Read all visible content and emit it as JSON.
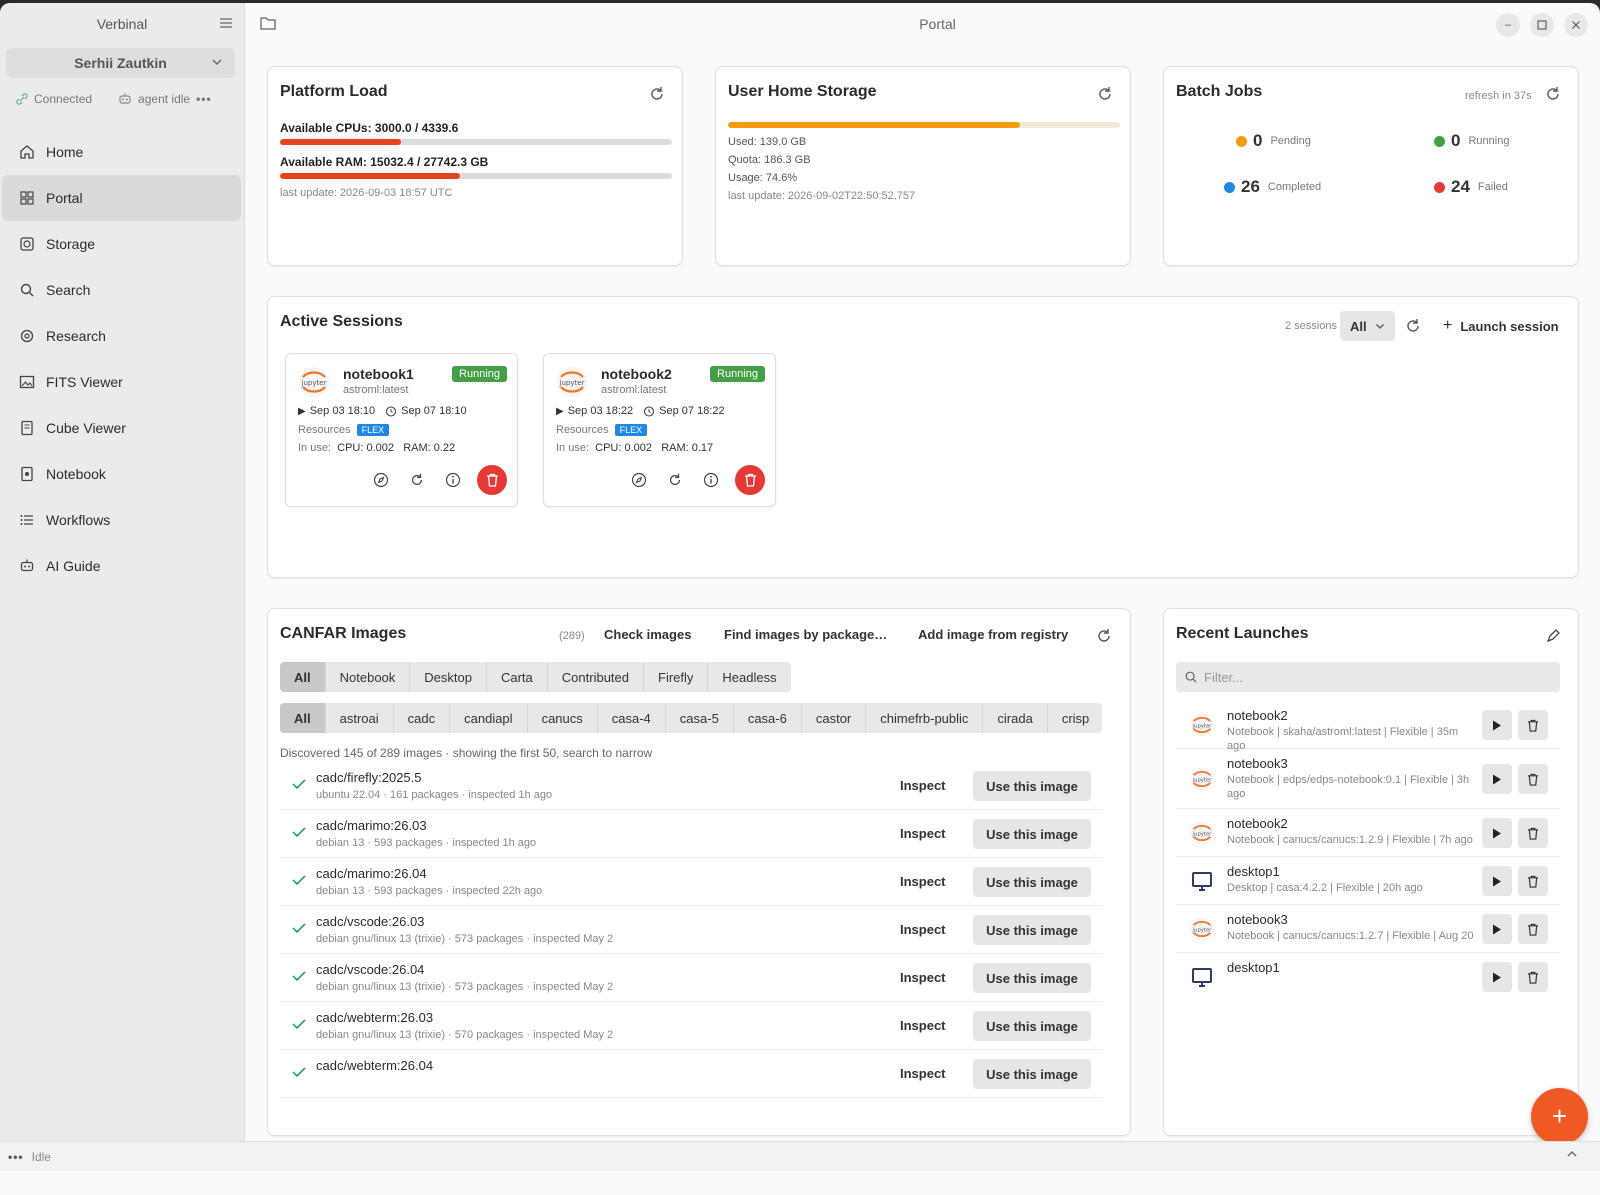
{
  "window": {
    "title": "Portal"
  },
  "sidebar": {
    "title": "Verbinal",
    "user": "Serhii Zautkin",
    "connection": "Connected",
    "agent": "agent idle",
    "items": [
      {
        "label": "Home",
        "icon": "home-icon"
      },
      {
        "label": "Portal",
        "icon": "grid-icon",
        "active": true
      },
      {
        "label": "Storage",
        "icon": "storage-icon"
      },
      {
        "label": "Search",
        "icon": "search-icon"
      },
      {
        "label": "Research",
        "icon": "research-icon"
      },
      {
        "label": "FITS Viewer",
        "icon": "image-icon"
      },
      {
        "label": "Cube Viewer",
        "icon": "cube-icon"
      },
      {
        "label": "Notebook",
        "icon": "notebook-icon"
      },
      {
        "label": "Workflows",
        "icon": "list-icon"
      },
      {
        "label": "AI Guide",
        "icon": "robot-icon"
      }
    ]
  },
  "platform_load": {
    "title": "Platform Load",
    "cpu_label": "Available CPUs: 3000.0 / 4339.6",
    "cpu_fraction": 0.309,
    "ram_label": "Available RAM: 15032.4 / 27742.3 GB",
    "ram_fraction": 0.458,
    "updated": "last update: 2026-09-03 18:57 UTC"
  },
  "storage": {
    "title": "User Home Storage",
    "usage_fraction": 0.746,
    "used": "Used: 139.0 GB",
    "quota": "Quota: 186.3 GB",
    "usage": "Usage: 74.6%",
    "updated": "last update: 2026-09-02T22:50:52.757"
  },
  "batch": {
    "title": "Batch Jobs",
    "refresh": "refresh in 37s",
    "pending": {
      "count": "0",
      "label": "Pending"
    },
    "running": {
      "count": "0",
      "label": "Running"
    },
    "completed": {
      "count": "26",
      "label": "Completed"
    },
    "failed": {
      "count": "24",
      "label": "Failed"
    }
  },
  "sessions": {
    "title": "Active Sessions",
    "count": "2 sessions",
    "filter": "All",
    "launch": "Launch session",
    "items": [
      {
        "name": "notebook1",
        "image": "astroml:latest",
        "status": "Running",
        "start": "Sep 03 18:10",
        "end": "Sep 07 18:10",
        "resources": "Resources",
        "flex": "FLEX",
        "in_use": "In use:",
        "cpu": "CPU: 0.002",
        "ram": "RAM: 0.22"
      },
      {
        "name": "notebook2",
        "image": "astroml:latest",
        "status": "Running",
        "start": "Sep 03 18:22",
        "end": "Sep 07 18:22",
        "resources": "Resources",
        "flex": "FLEX",
        "in_use": "In use:",
        "cpu": "CPU: 0.002",
        "ram": "RAM: 0.17"
      }
    ]
  },
  "images": {
    "title": "CANFAR Images",
    "count": "(289)",
    "check": "Check images",
    "find": "Find images by package…",
    "add": "Add image from registry",
    "types": [
      "All",
      "Notebook",
      "Desktop",
      "Carta",
      "Contributed",
      "Firefly",
      "Headless"
    ],
    "projects": [
      "All",
      "astroai",
      "cadc",
      "candiapl",
      "canucs",
      "casa-4",
      "casa-5",
      "casa-6",
      "castor",
      "chimefrb-public",
      "cirada",
      "crisp"
    ],
    "summary": "Discovered 145 of 289 images · showing the first 50, search to narrow",
    "inspect": "Inspect",
    "use": "Use this image",
    "rows": [
      {
        "name": "cadc/firefly:2025.5",
        "meta": "ubuntu 22.04 · 161 packages · inspected 1h ago"
      },
      {
        "name": "cadc/marimo:26.03",
        "meta": "debian 13 · 593 packages · inspected 1h ago"
      },
      {
        "name": "cadc/marimo:26.04",
        "meta": "debian 13 · 593 packages · inspected 22h ago"
      },
      {
        "name": "cadc/vscode:26.03",
        "meta": "debian gnu/linux 13 (trixie) · 573 packages · inspected May 2"
      },
      {
        "name": "cadc/vscode:26.04",
        "meta": "debian gnu/linux 13 (trixie) · 573 packages · inspected May 2"
      },
      {
        "name": "cadc/webterm:26.03",
        "meta": "debian gnu/linux 13 (trixie) · 570 packages · inspected May 2"
      },
      {
        "name": "cadc/webterm:26.04",
        "meta": ""
      }
    ]
  },
  "recent": {
    "title": "Recent Launches",
    "filter_placeholder": "Filter...",
    "rows": [
      {
        "name": "notebook2",
        "meta": "Notebook | skaha/astroml:latest | Flexible | 35m ago",
        "kind": "jupyter"
      },
      {
        "name": "notebook3",
        "meta": "Notebook | edps/edps-notebook:0.1 | Flexible | 3h ago",
        "kind": "jupyter"
      },
      {
        "name": "notebook2",
        "meta": "Notebook | canucs/canucs:1.2.9 | Flexible | 7h ago",
        "kind": "jupyter"
      },
      {
        "name": "desktop1",
        "meta": "Desktop | casa:4.2.2 | Flexible | 20h ago",
        "kind": "desktop"
      },
      {
        "name": "notebook3",
        "meta": "Notebook | canucs/canucs:1.2.7 | Flexible | Aug 20",
        "kind": "jupyter"
      },
      {
        "name": "desktop1",
        "meta": "",
        "kind": "desktop"
      }
    ]
  },
  "statusbar": {
    "text": "Idle"
  },
  "colors": {
    "accent": "#ef5a24",
    "running": "#43a047",
    "danger": "#e53935",
    "flex": "#1e88e5",
    "storage": "#f39c12"
  }
}
